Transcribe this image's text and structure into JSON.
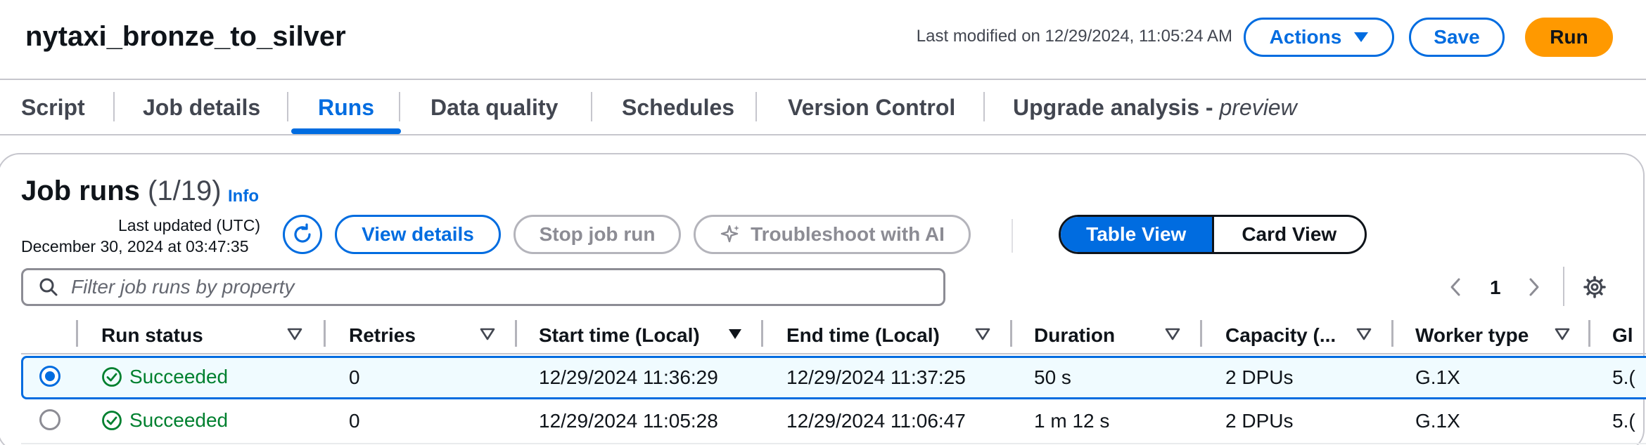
{
  "page": {
    "title": "nytaxi_bronze_to_silver",
    "last_modified": "Last modified on 12/29/2024, 11:05:24 AM"
  },
  "header_buttons": {
    "actions": "Actions",
    "save": "Save",
    "run": "Run"
  },
  "tabs": [
    {
      "label": "Script"
    },
    {
      "label": "Job details"
    },
    {
      "label": "Runs",
      "active": true
    },
    {
      "label": "Data quality"
    },
    {
      "label": "Schedules"
    },
    {
      "label": "Version Control"
    },
    {
      "label": "Upgrade analysis - ",
      "suffix": "preview"
    }
  ],
  "job_runs": {
    "heading": "Job runs",
    "count": "(1/19)",
    "info": "Info",
    "last_updated_label": "Last updated (UTC)",
    "last_updated_value": "December 30, 2024 at 03:47:35",
    "buttons": {
      "view_details": "View details",
      "stop_job_run": "Stop job run",
      "troubleshoot": "Troubleshoot with AI"
    },
    "view_toggle": {
      "table": "Table View",
      "card": "Card View",
      "selected": "Table View"
    },
    "filter_placeholder": "Filter job runs by property",
    "page_number": "1"
  },
  "table": {
    "columns": [
      {
        "label": "Run status"
      },
      {
        "label": "Retries"
      },
      {
        "label": "Start time (Local)",
        "sorted": "desc"
      },
      {
        "label": "End time (Local)"
      },
      {
        "label": "Duration"
      },
      {
        "label": "Capacity (..."
      },
      {
        "label": "Worker type"
      },
      {
        "label": "Gl"
      }
    ],
    "rows": [
      {
        "selected": true,
        "status": "Succeeded",
        "retries": "0",
        "start": "12/29/2024 11:36:29",
        "end": "12/29/2024 11:37:25",
        "duration": "50 s",
        "capacity": "2 DPUs",
        "worker": "G.1X",
        "glue": "5.("
      },
      {
        "selected": false,
        "status": "Succeeded",
        "retries": "0",
        "start": "12/29/2024 11:05:28",
        "end": "12/29/2024 11:06:47",
        "duration": "1 m 12 s",
        "capacity": "2 DPUs",
        "worker": "G.1X",
        "glue": "5.("
      }
    ]
  },
  "colors": {
    "accent": "#006ce0",
    "run_button": "#ff9900",
    "success": "#00802f",
    "selected_row_bg": "#f0fbff"
  }
}
